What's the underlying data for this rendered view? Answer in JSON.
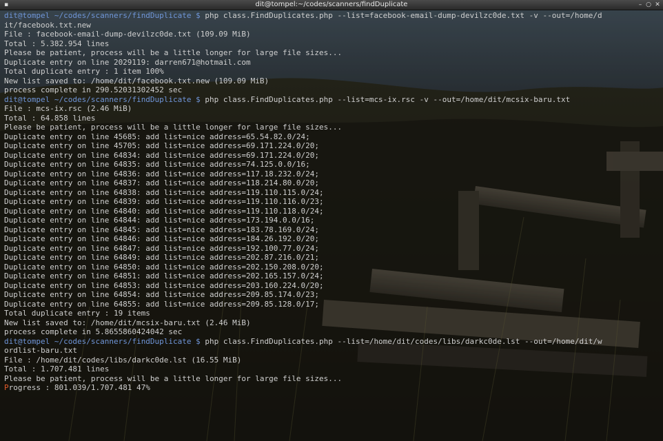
{
  "window": {
    "title": "dit@tompel:~/codes/scanners/findDuplicate"
  },
  "terminal": {
    "lines": [
      {
        "prompt": {
          "user": "dit@tompel",
          "path": "~/codes/scanners/findDuplicate $"
        },
        "text": " php class.FindDuplicates.php --list=facebook-email-dump-devilzc0de.txt -v --out=/home/d"
      },
      {
        "text": "it/facebook.txt.new"
      },
      {
        "text": "File : facebook-email-dump-devilzc0de.txt (109.09 MiB)"
      },
      {
        "text": "Total : 5.382.954 lines"
      },
      {
        "text": "Please be patient, process will be a little longer for large file sizes..."
      },
      {
        "text": "Duplicate entry on line 2029119: darren671@hotmail.com"
      },
      {
        "text": "Total duplicate entry : 1 item 100%"
      },
      {
        "text": "New list saved to: /home/dit/facebook.txt.new (109.09 MiB)"
      },
      {
        "text": "process complete in 290.52031302452 sec"
      },
      {
        "prompt": {
          "user": "dit@tompel",
          "path": "~/codes/scanners/findDuplicate $"
        },
        "text": " php class.FindDuplicates.php --list=mcs-ix.rsc -v --out=/home/dit/mcsix-baru.txt"
      },
      {
        "text": "File : mcs-ix.rsc (2.46 MiB)"
      },
      {
        "text": "Total : 64.858 lines"
      },
      {
        "text": "Please be patient, process will be a little longer for large file sizes..."
      },
      {
        "text": "Duplicate entry on line 45685: add list=nice address=65.54.82.0/24;"
      },
      {
        "text": "Duplicate entry on line 45705: add list=nice address=69.171.224.0/20;"
      },
      {
        "text": "Duplicate entry on line 64834: add list=nice address=69.171.224.0/20;"
      },
      {
        "text": "Duplicate entry on line 64835: add list=nice address=74.125.0.0/16;"
      },
      {
        "text": "Duplicate entry on line 64836: add list=nice address=117.18.232.0/24;"
      },
      {
        "text": "Duplicate entry on line 64837: add list=nice address=118.214.80.0/20;"
      },
      {
        "text": "Duplicate entry on line 64838: add list=nice address=119.110.115.0/24;"
      },
      {
        "text": "Duplicate entry on line 64839: add list=nice address=119.110.116.0/23;"
      },
      {
        "text": "Duplicate entry on line 64840: add list=nice address=119.110.118.0/24;"
      },
      {
        "text": "Duplicate entry on line 64844: add list=nice address=173.194.0.0/16;"
      },
      {
        "text": "Duplicate entry on line 64845: add list=nice address=183.78.169.0/24;"
      },
      {
        "text": "Duplicate entry on line 64846: add list=nice address=184.26.192.0/20;"
      },
      {
        "text": "Duplicate entry on line 64847: add list=nice address=192.100.77.0/24;"
      },
      {
        "text": "Duplicate entry on line 64849: add list=nice address=202.87.216.0/21;"
      },
      {
        "text": "Duplicate entry on line 64850: add list=nice address=202.150.208.0/20;"
      },
      {
        "text": "Duplicate entry on line 64851: add list=nice address=202.165.157.0/24;"
      },
      {
        "text": "Duplicate entry on line 64853: add list=nice address=203.160.224.0/20;"
      },
      {
        "text": "Duplicate entry on line 64854: add list=nice address=209.85.174.0/23;"
      },
      {
        "text": "Duplicate entry on line 64855: add list=nice address=209.85.128.0/17;"
      },
      {
        "text": "Total duplicate entry : 19 items"
      },
      {
        "text": "New list saved to: /home/dit/mcsix-baru.txt (2.46 MiB)"
      },
      {
        "text": "process complete in 5.8655860424042 sec"
      },
      {
        "prompt": {
          "user": "dit@tompel",
          "path": "~/codes/scanners/findDuplicate $"
        },
        "text": " php class.FindDuplicates.php --list=/home/dit/codes/libs/darkc0de.lst --out=/home/dit/w"
      },
      {
        "text": "ordlist-baru.txt"
      },
      {
        "text": "File : /home/dit/codes/libs/darkc0de.lst (16.55 MiB)"
      },
      {
        "text": "Total : 1.707.481 lines"
      },
      {
        "text": "Please be patient, process will be a little longer for large file sizes..."
      },
      {
        "cursor": true,
        "text": "rogress : 801.039/1.707.481 47%",
        "cursor_char": "P"
      }
    ]
  },
  "colors": {
    "prompt": "#6f95d8",
    "text": "#cfcfcf",
    "cursor": "#e25a2a"
  },
  "icons": {
    "menu": "terminal-menu-icon",
    "minimize": "minimize-icon",
    "maximize": "maximize-icon",
    "close": "close-icon"
  }
}
